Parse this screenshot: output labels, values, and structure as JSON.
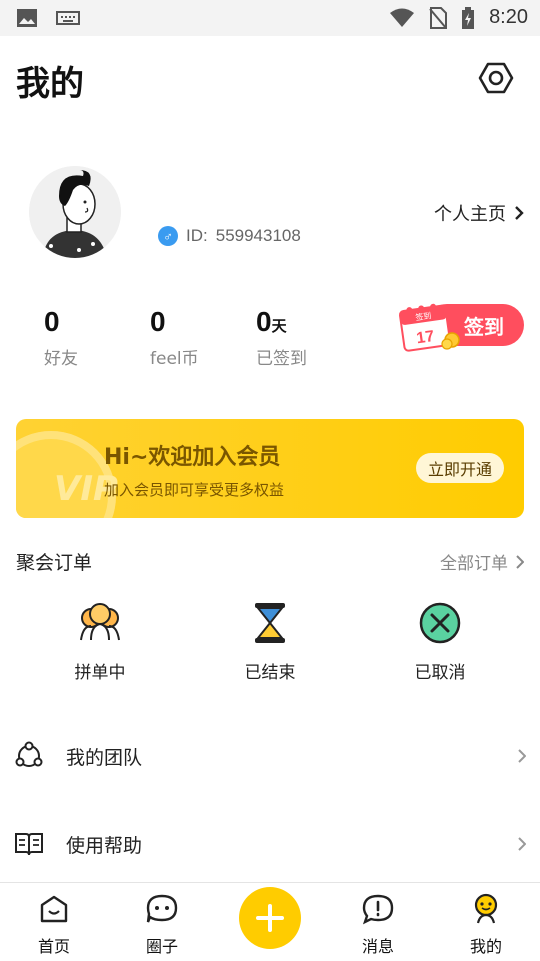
{
  "status_bar": {
    "time": "8:20"
  },
  "header": {
    "title": "我的"
  },
  "profile": {
    "id_label": "ID:",
    "id_value": "559943108",
    "homepage_link": "个人主页"
  },
  "stats": [
    {
      "value": "0",
      "unit": "",
      "label": "好友"
    },
    {
      "value": "0",
      "unit": "",
      "label": "feel币"
    },
    {
      "value": "0",
      "unit": "天",
      "label": "已签到"
    }
  ],
  "signin": {
    "label": "签到",
    "calendar_tab": "签到",
    "calendar_day": "17"
  },
  "vip_banner": {
    "coin_text": "VIP",
    "title": "Hi~欢迎加入会员",
    "subtitle": "加入会员即可享受更多权益",
    "button": "立即开通"
  },
  "orders": {
    "title": "聚会订单",
    "all_link": "全部订单",
    "items": [
      {
        "label": "拼单中",
        "icon": "group-people-icon"
      },
      {
        "label": "已结束",
        "icon": "hourglass-icon"
      },
      {
        "label": "已取消",
        "icon": "cancel-x-icon"
      }
    ]
  },
  "menu": [
    {
      "label": "我的团队",
      "icon": "team-icon"
    },
    {
      "label": "使用帮助",
      "icon": "book-icon"
    }
  ],
  "bottom_nav": [
    {
      "label": "首页",
      "icon": "home-icon"
    },
    {
      "label": "圈子",
      "icon": "chat-bubble-icon"
    },
    {
      "label": "",
      "icon": "plus-icon"
    },
    {
      "label": "消息",
      "icon": "message-icon"
    },
    {
      "label": "我的",
      "icon": "profile-icon"
    }
  ],
  "colors": {
    "accent_yellow": "#ffcc00",
    "signin_red": "#ff4e5e",
    "id_blue": "#3a9bf0"
  }
}
